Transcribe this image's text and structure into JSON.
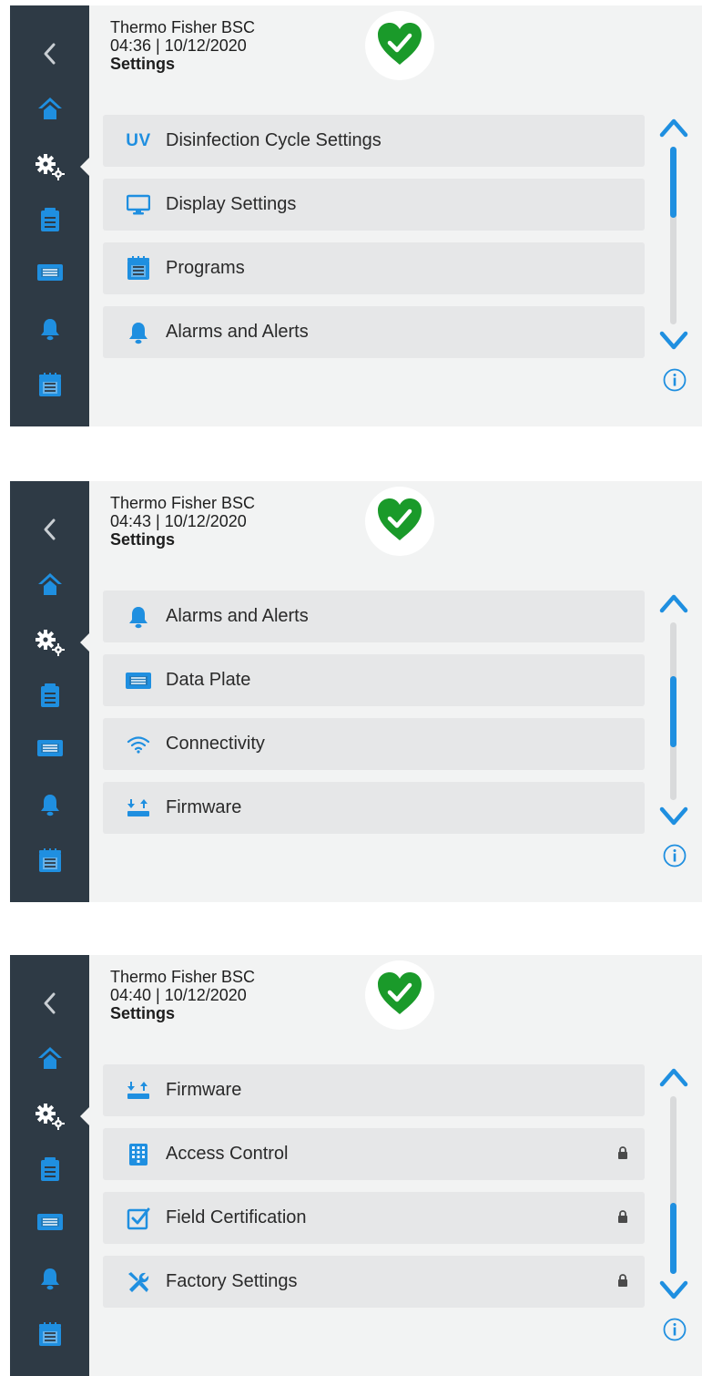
{
  "accent_color": "#1f8fe0",
  "sidebar_color": "#2e3a45",
  "status_color": "#1a9a2a",
  "sidebar_icons": [
    "back-icon",
    "home-icon",
    "gears-icon",
    "clipboard-icon",
    "data-plate-icon",
    "bell-icon",
    "programs-icon"
  ],
  "screens": [
    {
      "device": "Thermo Fisher BSC",
      "datetime": "04:36 | 10/12/2020",
      "title": "Settings",
      "scroll_position": 0.0,
      "items": [
        {
          "icon": "uv-icon",
          "icon_text": "UV",
          "label": "Disinfection Cycle Settings",
          "locked": false
        },
        {
          "icon": "monitor-icon",
          "label": "Display Settings",
          "locked": false
        },
        {
          "icon": "programs-icon",
          "label": "Programs",
          "locked": false
        },
        {
          "icon": "bell-icon",
          "label": "Alarms and Alerts",
          "locked": false
        }
      ]
    },
    {
      "device": "Thermo Fisher BSC",
      "datetime": "04:43 | 10/12/2020",
      "title": "Settings",
      "scroll_position": 0.5,
      "items": [
        {
          "icon": "bell-icon",
          "label": "Alarms and Alerts",
          "locked": false
        },
        {
          "icon": "data-plate-icon",
          "label": "Data Plate",
          "locked": false
        },
        {
          "icon": "wifi-icon",
          "label": "Connectivity",
          "locked": false
        },
        {
          "icon": "firmware-icon",
          "label": "Firmware",
          "locked": false
        }
      ]
    },
    {
      "device": "Thermo Fisher BSC",
      "datetime": "04:40 | 10/12/2020",
      "title": "Settings",
      "scroll_position": 1.0,
      "items": [
        {
          "icon": "firmware-icon",
          "label": "Firmware",
          "locked": false
        },
        {
          "icon": "keypad-icon",
          "label": "Access Control",
          "locked": true
        },
        {
          "icon": "checkbox-icon",
          "label": "Field Certification",
          "locked": true
        },
        {
          "icon": "tools-icon",
          "label": "Factory Settings",
          "locked": true
        }
      ]
    }
  ]
}
